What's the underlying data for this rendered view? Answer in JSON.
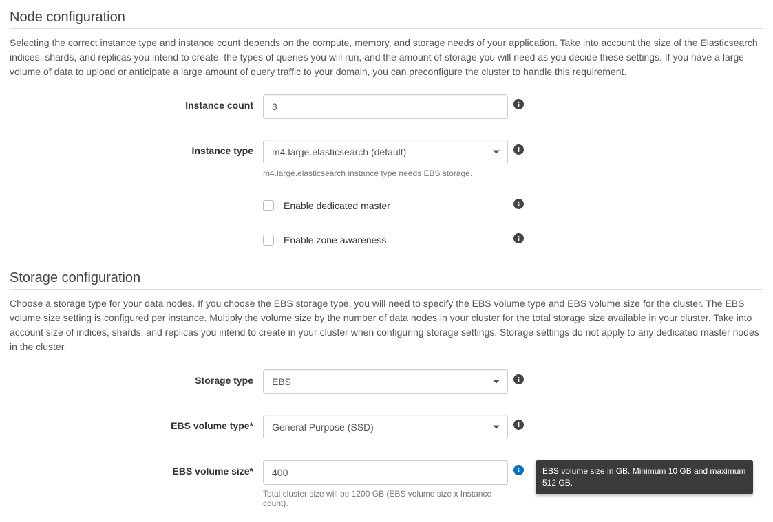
{
  "node": {
    "heading": "Node configuration",
    "description": "Selecting the correct instance type and instance count depends on the compute, memory, and storage needs of your application. Take into account the size of the Elasticsearch indices, shards, and replicas you intend to create, the types of queries you will run, and the amount of storage you will need as you decide these settings. If you have a large volume of data to upload or anticipate a large amount of query traffic to your domain, you can preconfigure the cluster to handle this requirement.",
    "instance_count_label": "Instance count",
    "instance_count_value": "3",
    "instance_type_label": "Instance type",
    "instance_type_value": "m4.large.elasticsearch (default)",
    "instance_type_help": "m4.large.elasticsearch instance type needs EBS storage.",
    "dedicated_master_label": "Enable dedicated master",
    "zone_awareness_label": "Enable zone awareness"
  },
  "storage": {
    "heading": "Storage configuration",
    "description": "Choose a storage type for your data nodes. If you choose the EBS storage type, you will need to specify the EBS volume type and EBS volume size for the cluster. The EBS volume size setting is configured per instance. Multiply the volume size by the number of data nodes in your cluster for the total storage size available in your cluster. Take into account size of indices, shards, and replicas you intend to create in your cluster when configuring storage settings. Storage settings do not apply to any dedicated master nodes in the cluster.",
    "storage_type_label": "Storage type",
    "storage_type_value": "EBS",
    "ebs_volume_type_label": "EBS volume type*",
    "ebs_volume_type_value": "General Purpose (SSD)",
    "ebs_volume_size_label": "EBS volume size*",
    "ebs_volume_size_value": "400",
    "ebs_volume_size_help": "Total cluster size will be 1200 GB (EBS volume size x Instance count).",
    "ebs_volume_size_tooltip": "EBS volume size in GB. Minimum 10 GB and maximum 512 GB."
  }
}
